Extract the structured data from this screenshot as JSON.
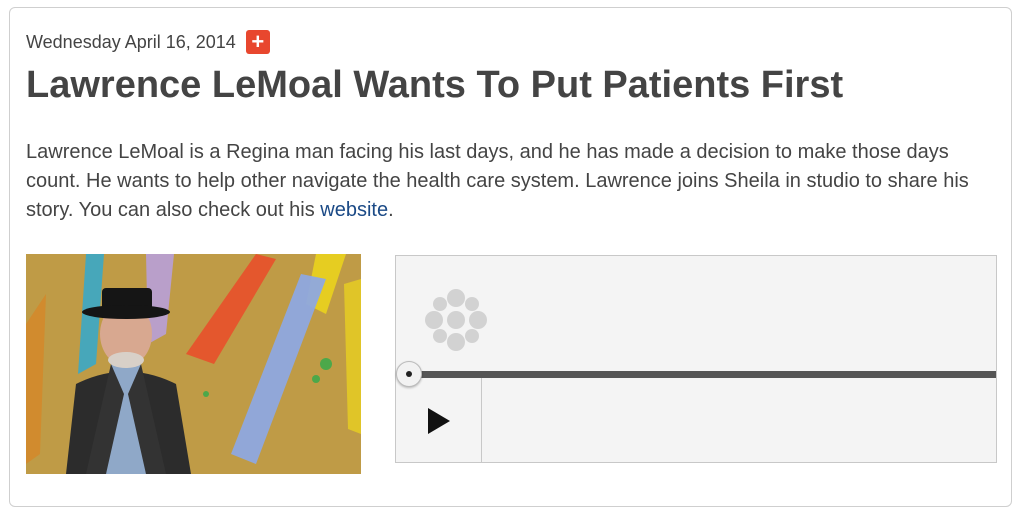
{
  "article": {
    "date": "Wednesday April 16, 2014",
    "add_icon": "plus-icon",
    "title": "Lawrence LeMoal Wants To Put Patients First",
    "summary_text": "Lawrence LeMoal is a Regina man facing his last days, and he has made a decision to make those days count. He wants to help other navigate the health care system. Lawrence joins Sheila in studio to share his story. You can also check out his ",
    "summary_link": "website",
    "summary_end": "."
  },
  "player": {
    "logo_icon": "cbc-gem-icon",
    "play_icon": "play-icon",
    "progress": 0
  },
  "colors": {
    "accent": "#e8472e",
    "link": "#1b4a86",
    "text": "#444444"
  }
}
